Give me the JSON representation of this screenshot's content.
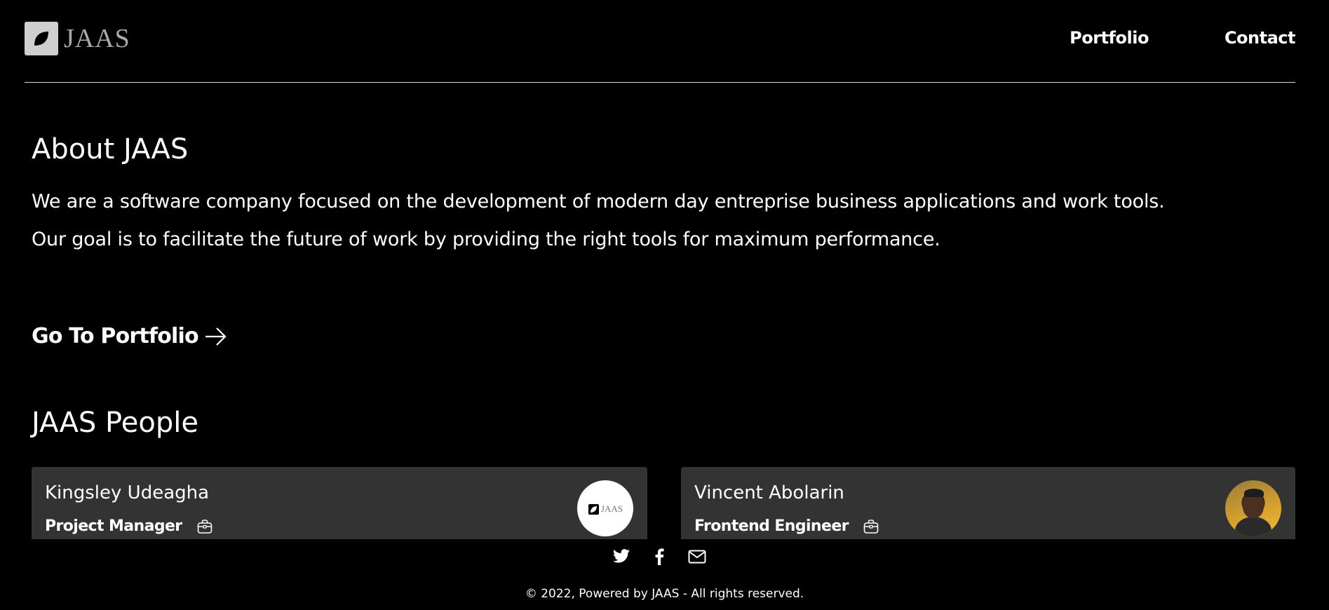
{
  "header": {
    "logo_text": "JAAS",
    "nav": [
      {
        "label": "Portfolio"
      },
      {
        "label": "Contact"
      }
    ]
  },
  "about": {
    "title": "About JAAS",
    "paragraph1": "We are a software company focused on the development of modern day entreprise business applications and work tools.",
    "paragraph2": "Our goal is to facilitate the future of work by providing the right tools for maximum performance.",
    "goto_label": "Go To Portfolio",
    "goto_icon": "arrow-right-icon"
  },
  "people": {
    "title": "JAAS People",
    "cards": [
      {
        "name": "Kingsley Udeagha",
        "role": "Project Manager",
        "role_icon": "briefcase-icon",
        "avatar_text": "JAAS"
      },
      {
        "name": "Vincent Abolarin",
        "role": "Frontend Engineer",
        "role_icon": "briefcase-icon"
      }
    ]
  },
  "footer": {
    "social_icons": [
      "twitter-icon",
      "facebook-icon",
      "mail-icon"
    ],
    "copyright": "© 2022, Powered by JAAS - All rights reserved."
  },
  "colors": {
    "background": "#000000",
    "card": "#333333",
    "text": "#ffffff",
    "logo_box": "#cfcfcf"
  }
}
